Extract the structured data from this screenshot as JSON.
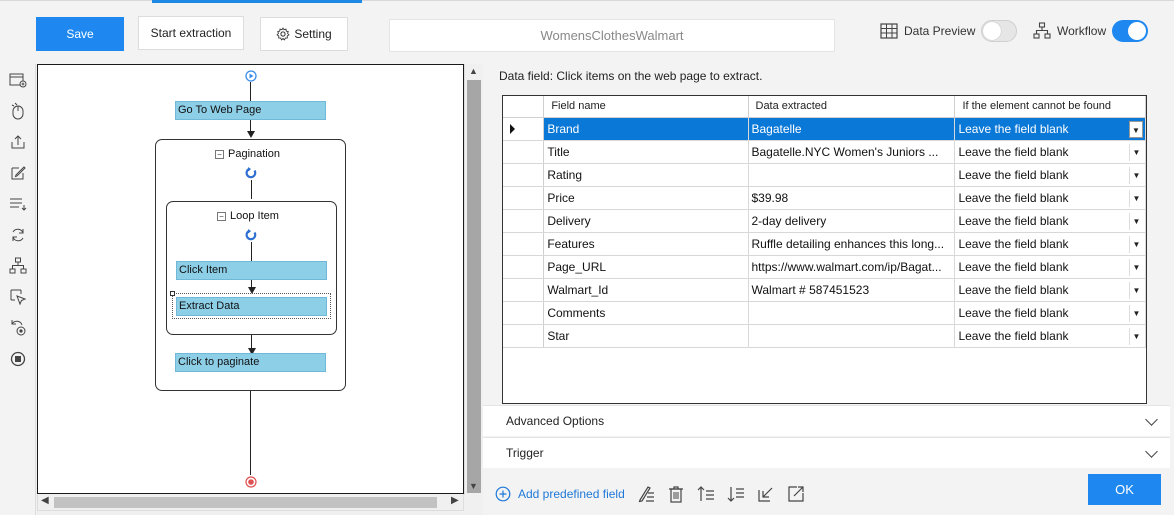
{
  "toolbar": {
    "save_label": "Save",
    "start_label": "Start extraction",
    "setting_label": "Setting",
    "task_name": "WomensClothesWalmart",
    "data_preview_label": "Data Preview",
    "data_preview_on": false,
    "workflow_label": "Workflow",
    "workflow_on": true
  },
  "workflow": {
    "go_to_web_page": "Go To Web Page",
    "pagination": "Pagination",
    "loop_item": "Loop Item",
    "click_item": "Click Item",
    "extract_data": "Extract Data",
    "click_to_paginate": "Click to paginate"
  },
  "panel": {
    "title": "Data field: Click items on the web page to extract.",
    "columns": [
      "Field name",
      "Data extracted",
      "If the element cannot be found"
    ],
    "rows": [
      {
        "field": "Brand",
        "data": "Bagatelle",
        "fallback": "Leave the field blank"
      },
      {
        "field": "Title",
        "data": "Bagatelle.NYC Women's Juniors ...",
        "fallback": "Leave the field blank"
      },
      {
        "field": "Rating",
        "data": "",
        "fallback": "Leave the field blank"
      },
      {
        "field": "Price",
        "data": "$39.98",
        "fallback": "Leave the field blank"
      },
      {
        "field": "Delivery",
        "data": "2-day delivery",
        "fallback": "Leave the field blank"
      },
      {
        "field": "Features",
        "data": "Ruffle detailing enhances this long...",
        "fallback": "Leave the field blank"
      },
      {
        "field": "Page_URL",
        "data": "https://www.walmart.com/ip/Bagat...",
        "fallback": "Leave the field blank"
      },
      {
        "field": "Walmart_Id",
        "data": "Walmart #  587451523",
        "fallback": "Leave the field blank"
      },
      {
        "field": "Comments",
        "data": "",
        "fallback": "Leave the field blank"
      },
      {
        "field": "Star",
        "data": "",
        "fallback": "Leave the field blank"
      }
    ],
    "selected_row": 0,
    "advanced_options": "Advanced Options",
    "trigger": "Trigger",
    "add_predefined_field": "Add predefined field",
    "ok_label": "OK"
  },
  "colors": {
    "accent": "#1e88f0",
    "step_fill": "#8ecfe8",
    "selection": "#0a78d7"
  }
}
